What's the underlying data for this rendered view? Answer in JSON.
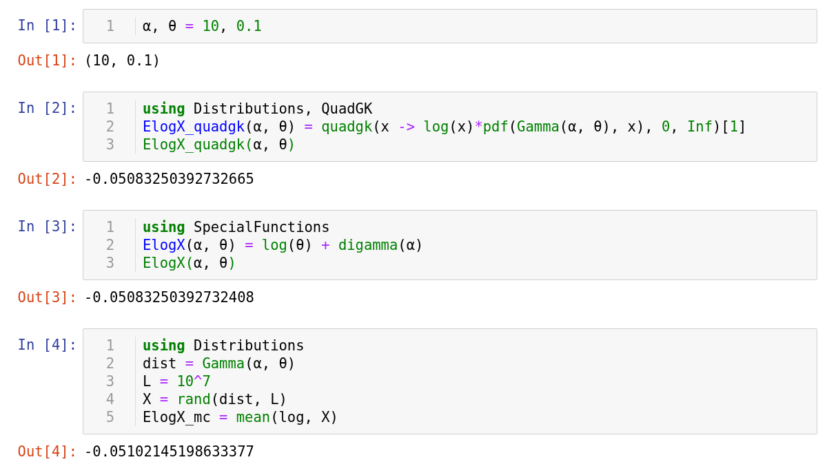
{
  "cells": [
    {
      "prompt_in": "In [1]:",
      "lines": [
        {
          "number": "1",
          "tokens": [
            {
              "kind": "plain",
              "text": "α, θ "
            },
            {
              "kind": "op",
              "text": "= "
            },
            {
              "kind": "number",
              "text": "10"
            },
            {
              "kind": "plain",
              "text": ", "
            },
            {
              "kind": "number",
              "text": "0.1"
            }
          ]
        }
      ],
      "prompt_out": "Out[1]:",
      "output": "(10, 0.1)"
    },
    {
      "prompt_in": "In [2]:",
      "lines": [
        {
          "number": "1",
          "tokens": [
            {
              "kind": "keyword",
              "text": "using"
            },
            {
              "kind": "plain",
              "text": " Distributions, QuadGK"
            }
          ]
        },
        {
          "number": "2",
          "tokens": [
            {
              "kind": "def",
              "text": "ElogX_quadgk"
            },
            {
              "kind": "plain",
              "text": "(α, θ) "
            },
            {
              "kind": "op",
              "text": "= "
            },
            {
              "kind": "call",
              "text": "quadgk"
            },
            {
              "kind": "plain",
              "text": "(x "
            },
            {
              "kind": "op",
              "text": "-> "
            },
            {
              "kind": "call",
              "text": "log"
            },
            {
              "kind": "plain",
              "text": "(x)"
            },
            {
              "kind": "op",
              "text": "*"
            },
            {
              "kind": "call",
              "text": "pdf"
            },
            {
              "kind": "plain",
              "text": "("
            },
            {
              "kind": "call",
              "text": "Gamma"
            },
            {
              "kind": "plain",
              "text": "(α, θ), x), "
            },
            {
              "kind": "number",
              "text": "0"
            },
            {
              "kind": "plain",
              "text": ", "
            },
            {
              "kind": "call",
              "text": "Inf"
            },
            {
              "kind": "plain",
              "text": ")["
            },
            {
              "kind": "number",
              "text": "1"
            },
            {
              "kind": "plain",
              "text": "]"
            }
          ]
        },
        {
          "number": "3",
          "tokens": [
            {
              "kind": "call",
              "text": "ElogX_quadgk("
            },
            {
              "kind": "plain",
              "text": "α, θ"
            },
            {
              "kind": "call",
              "text": ")"
            }
          ]
        }
      ],
      "prompt_out": "Out[2]:",
      "output": "-0.05083250392732665"
    },
    {
      "prompt_in": "In [3]:",
      "lines": [
        {
          "number": "1",
          "tokens": [
            {
              "kind": "keyword",
              "text": "using"
            },
            {
              "kind": "plain",
              "text": " SpecialFunctions"
            }
          ]
        },
        {
          "number": "2",
          "tokens": [
            {
              "kind": "def",
              "text": "ElogX"
            },
            {
              "kind": "plain",
              "text": "(α, θ) "
            },
            {
              "kind": "op",
              "text": "= "
            },
            {
              "kind": "call",
              "text": "log"
            },
            {
              "kind": "plain",
              "text": "(θ) "
            },
            {
              "kind": "op",
              "text": "+ "
            },
            {
              "kind": "call",
              "text": "digamma"
            },
            {
              "kind": "plain",
              "text": "(α)"
            }
          ]
        },
        {
          "number": "3",
          "tokens": [
            {
              "kind": "call",
              "text": "ElogX("
            },
            {
              "kind": "plain",
              "text": "α, θ"
            },
            {
              "kind": "call",
              "text": ")"
            }
          ]
        }
      ],
      "prompt_out": "Out[3]:",
      "output": "-0.05083250392732408"
    },
    {
      "prompt_in": "In [4]:",
      "lines": [
        {
          "number": "1",
          "tokens": [
            {
              "kind": "keyword",
              "text": "using"
            },
            {
              "kind": "plain",
              "text": " Distributions"
            }
          ]
        },
        {
          "number": "2",
          "tokens": [
            {
              "kind": "plain",
              "text": "dist "
            },
            {
              "kind": "op",
              "text": "= "
            },
            {
              "kind": "call",
              "text": "Gamma"
            },
            {
              "kind": "plain",
              "text": "(α, θ)"
            }
          ]
        },
        {
          "number": "3",
          "tokens": [
            {
              "kind": "plain",
              "text": "L "
            },
            {
              "kind": "op",
              "text": "= "
            },
            {
              "kind": "number",
              "text": "10"
            },
            {
              "kind": "op",
              "text": "^"
            },
            {
              "kind": "number",
              "text": "7"
            }
          ]
        },
        {
          "number": "4",
          "tokens": [
            {
              "kind": "plain",
              "text": "X "
            },
            {
              "kind": "op",
              "text": "= "
            },
            {
              "kind": "call",
              "text": "rand"
            },
            {
              "kind": "plain",
              "text": "(dist, L)"
            }
          ]
        },
        {
          "number": "5",
          "tokens": [
            {
              "kind": "plain",
              "text": "ElogX_mc "
            },
            {
              "kind": "op",
              "text": "= "
            },
            {
              "kind": "call",
              "text": "mean"
            },
            {
              "kind": "plain",
              "text": "(log, X)"
            }
          ]
        }
      ],
      "prompt_out": "Out[4]:",
      "output": "-0.05102145198633377"
    }
  ]
}
